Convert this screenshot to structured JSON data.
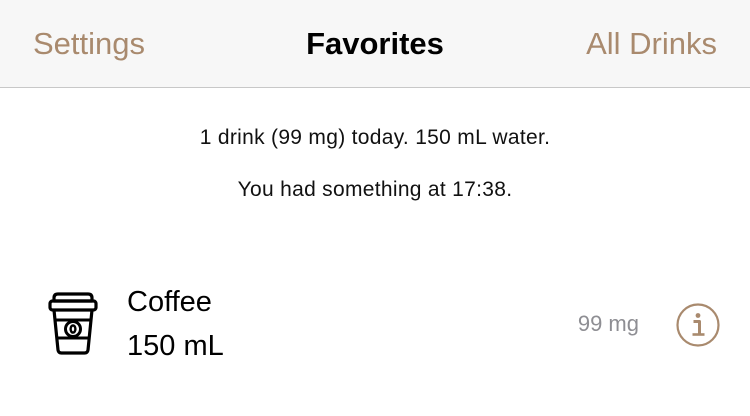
{
  "navbar": {
    "left_label": "Settings",
    "title": "Favorites",
    "right_label": "All Drinks"
  },
  "summary": {
    "line1": "1 drink (99 mg) today. 150 mL water.",
    "line2": "You had something at 17:38."
  },
  "favorites": [
    {
      "name": "Coffee",
      "volume": "150 mL",
      "caffeine": "99 mg",
      "icon": "coffee-cup-icon",
      "info_icon": "info-icon"
    }
  ],
  "colors": {
    "accent": "#a98a6e",
    "navbar_bg": "#f7f7f7",
    "separator": "#c8c8c8",
    "secondary_text": "#8e8e93",
    "text": "#000000"
  }
}
